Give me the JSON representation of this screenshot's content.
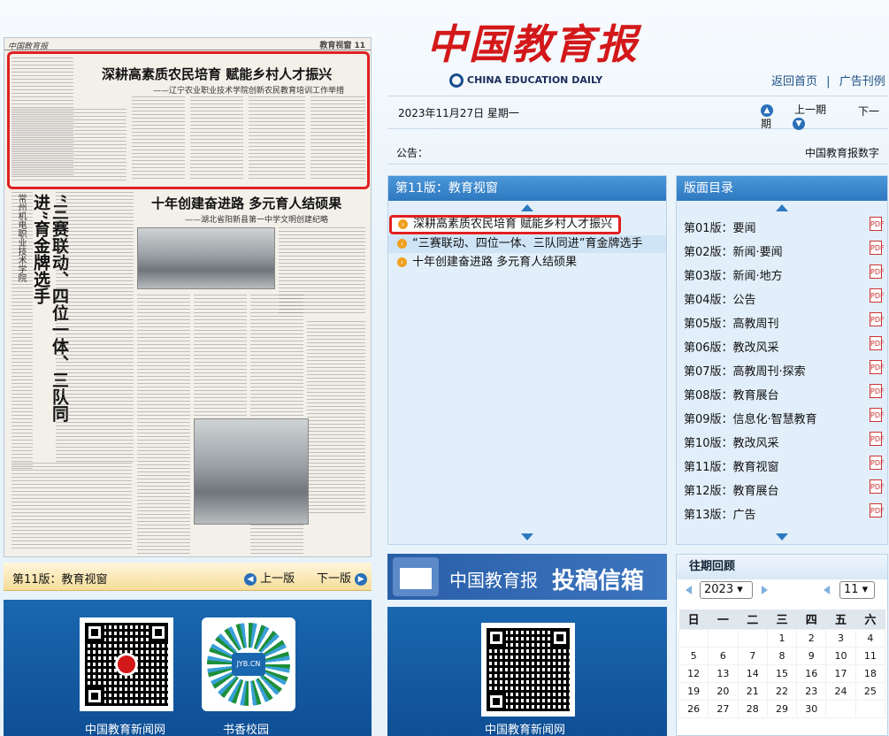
{
  "newspaper": {
    "masthead": "中国教育报",
    "section": "教育视窗 11",
    "lead_title": "深耕高素质农民培育 赋能乡村人才振兴",
    "lead_subtitle": "——辽宁农业职业技术学院创新农民教育培训工作举措",
    "title2": "十年创建奋进路 多元育人结硕果",
    "subtitle2": "——湖北省阳新县第一中学文明创建纪略",
    "vertical_title": "“三赛联动、四位一体、三队同进”育金牌选手",
    "vertical_sub": "常州机电职业技术学院"
  },
  "left_bar": {
    "page_label": "第11版：教育视窗",
    "prev": "上一版",
    "next": "下一版"
  },
  "qr_left": [
    {
      "caption": "中国教育新闻网"
    },
    {
      "caption": "书香校园",
      "logo": "JYB.CN"
    }
  ],
  "brand": {
    "title": "中国教育报",
    "english": "CHINA EDUCATION DAILY"
  },
  "top_links": {
    "home": "返回首页",
    "sep": "|",
    "ads": "广告刊例"
  },
  "date_bar": {
    "date": "2023年11月27日 星期一",
    "prev_issue": "上一期",
    "next_issue": "下一"
  },
  "notice": {
    "label": "公告：",
    "text": "中国教育报数字"
  },
  "articles_panel": {
    "title": "第11版：教育视窗",
    "items": [
      "深耕高素质农民培育 赋能乡村人才振兴",
      "“三赛联动、四位一体、三队同进”育金牌选手",
      "十年创建奋进路 多元育人结硕果"
    ]
  },
  "pages_panel": {
    "title": "版面目录",
    "items": [
      "第01版：要闻",
      "第02版：新闻·要闻",
      "第03版：新闻·地方",
      "第04版：公告",
      "第05版：高教周刊",
      "第06版：教改风采",
      "第07版：高教周刊·探索",
      "第08版：教育展台",
      "第09版：信息化·智慧教育",
      "第10版：教改风采",
      "第11版：教育视窗",
      "第12版：教育展台",
      "第13版：广告"
    ],
    "pdf_label": "PDF"
  },
  "mailbox": {
    "brand": "中国教育报",
    "title": "投稿信箱"
  },
  "qr_center": {
    "caption": "中国教育新闻网"
  },
  "calendar": {
    "title": "往期回顾",
    "year": "2023",
    "month": "11",
    "weekdays": [
      "日",
      "一",
      "二",
      "三",
      "四",
      "五",
      "六"
    ],
    "weeks": [
      [
        "",
        "",
        "",
        "1",
        "2",
        "3",
        "4"
      ],
      [
        "5",
        "6",
        "7",
        "8",
        "9",
        "10",
        "11"
      ],
      [
        "12",
        "13",
        "14",
        "15",
        "16",
        "17",
        "18"
      ],
      [
        "19",
        "20",
        "21",
        "22",
        "23",
        "24",
        "25"
      ],
      [
        "26",
        "27",
        "28",
        "29",
        "30",
        "",
        ""
      ]
    ]
  },
  "colors": {
    "accent": "#2d78c0",
    "highlight": "#e02020",
    "brand_red": "#d3181a"
  }
}
